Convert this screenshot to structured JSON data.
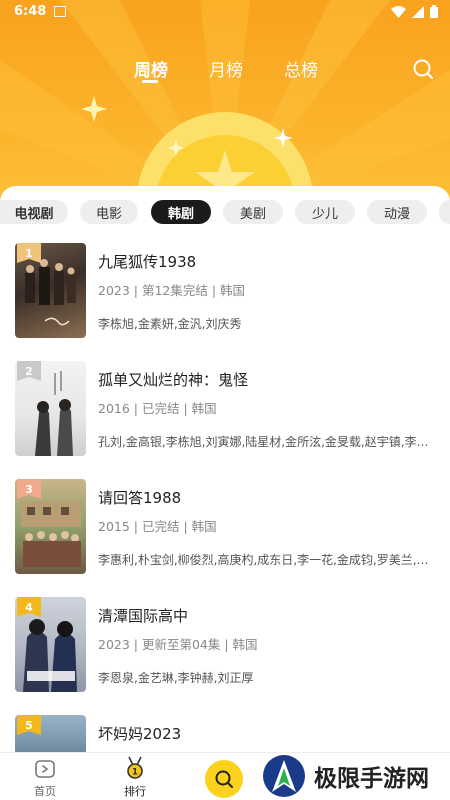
{
  "status_bar": {
    "time": "6:48"
  },
  "top_tabs": [
    {
      "label": "周榜",
      "active": true
    },
    {
      "label": "月榜",
      "active": false
    },
    {
      "label": "总榜",
      "active": false
    }
  ],
  "categories": [
    {
      "label": "电视剧",
      "active": false
    },
    {
      "label": "电影",
      "active": false
    },
    {
      "label": "韩剧",
      "active": true
    },
    {
      "label": "美剧",
      "active": false
    },
    {
      "label": "少儿",
      "active": false
    },
    {
      "label": "动漫",
      "active": false
    }
  ],
  "items": [
    {
      "rank": "1",
      "title": "九尾狐传1938",
      "meta": "2023 | 第12集完结 | 韩国",
      "cast": "李栋旭,金素妍,金汎,刘庆秀"
    },
    {
      "rank": "2",
      "title": "孤单又灿烂的神：鬼怪",
      "meta": "2016 | 已完结 | 韩国",
      "cast": "孔刘,金高银,李栋旭,刘寅娜,陆星材,金所泫,金旻载,赵宇镇,李艾..."
    },
    {
      "rank": "3",
      "title": "请回答1988",
      "meta": "2015 | 已完结 | 韩国",
      "cast": "李惠利,朴宝剑,柳俊烈,高庚杓,成东日,李一花,金成钧,罗美兰,李..."
    },
    {
      "rank": "4",
      "title": "清潭国际高中",
      "meta": "2023 | 更新至第04集 | 韩国",
      "cast": "李恩泉,金艺琳,李钟赫,刘正厚"
    },
    {
      "rank": "5",
      "title": "坏妈妈2023",
      "meta": "",
      "cast": ""
    }
  ],
  "bottom_nav": {
    "home_label": "首页",
    "rank_label": "排行"
  },
  "watermark": {
    "text": "极限手游网"
  }
}
